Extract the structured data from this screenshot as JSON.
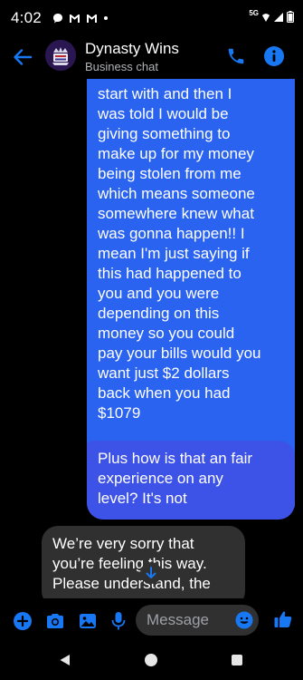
{
  "status_bar": {
    "time": "4:02",
    "network": "5G",
    "left_icons": [
      "chat-bubble-icon",
      "gmail-icon",
      "gmail-icon",
      "dot-icon"
    ],
    "right_icons": [
      "wifi-icon",
      "signal-icon",
      "battery-icon"
    ]
  },
  "header": {
    "title": "Dynasty Wins",
    "subtitle": "Business chat",
    "icons": [
      "back-arrow-icon",
      "avatar",
      "phone-icon",
      "info-icon"
    ]
  },
  "messages": [
    {
      "direction": "outgoing",
      "text": "start with and then I\nwas told I would be\ngiving something to\nmake up for my money\nbeing stolen from me\nwhich means someone\nsomewhere knew what\nwas gonna happen!! I\nmean I'm just saying if\nthis had happened to\nyou and you were\ndepending on this\nmoney so you could\npay your bills would you\nwant just $2 dollars\nback when you had\n$1079"
    },
    {
      "direction": "outgoing",
      "text": "Plus how is that an fair\nexperience on any\nlevel? It's not"
    },
    {
      "direction": "incoming",
      "text": "We’re very sorry that\nyou’re feeling this way.\nPlease understand, the"
    }
  ],
  "composer": {
    "placeholder": "Message",
    "icons": [
      "plus-icon",
      "camera-icon",
      "gallery-icon",
      "microphone-icon",
      "emoji-icon",
      "thumbs-up-icon"
    ]
  },
  "colors": {
    "accent": "#1877f2",
    "outgoing_bubble": "#2a63ef",
    "outgoing_bubble_2": "#3d52e6",
    "incoming_bubble": "#303030",
    "background": "#000000"
  }
}
